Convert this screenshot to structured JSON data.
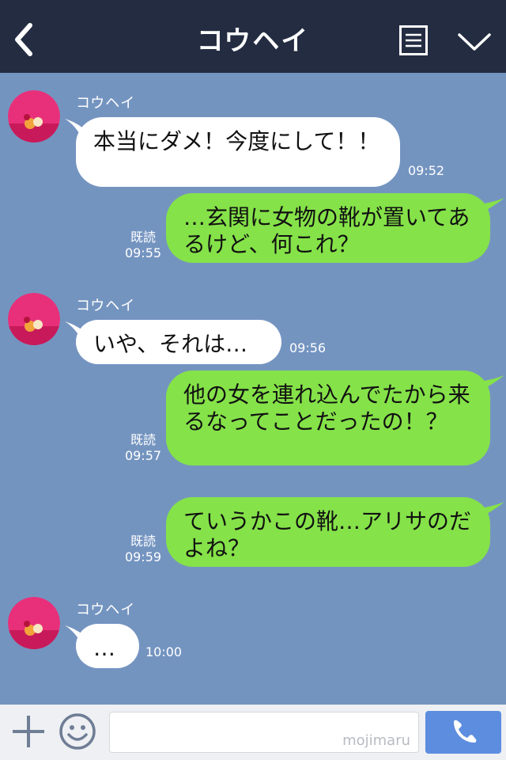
{
  "header": {
    "title": "コウヘイ",
    "back_icon": "chevron-left-icon",
    "menu_icon": "list-menu-icon",
    "expand_icon": "chevron-down-icon"
  },
  "messages": [
    {
      "side": "left",
      "sender": "コウヘイ",
      "text": "本当にダメ！今度にして！！",
      "time": "09:52"
    },
    {
      "side": "right",
      "read": "既読",
      "text": "…玄関に女物の靴が置いてあるけど、何これ？",
      "time": "09:55"
    },
    {
      "side": "left",
      "sender": "コウヘイ",
      "text": "いや、それは…",
      "time": "09:56"
    },
    {
      "side": "right",
      "read": "既読",
      "text": "他の女を連れ込んでたから来るなってことだったの！？",
      "time": "09:57"
    },
    {
      "side": "right",
      "read": "既読",
      "text": "ていうかこの靴…アリサのだよね？",
      "time": "09:59"
    },
    {
      "side": "left",
      "sender": "コウヘイ",
      "text": "…",
      "time": "10:00"
    }
  ],
  "input": {
    "watermark": "mojimaru",
    "plus_icon": "plus-icon",
    "sticker_icon": "smiley-icon",
    "call_icon": "phone-icon"
  },
  "colors": {
    "header_bg": "#232c41",
    "chat_bg": "#7494c0",
    "left_bubble": "#ffffff",
    "right_bubble": "#85e249",
    "call_button": "#5d8ddf"
  }
}
